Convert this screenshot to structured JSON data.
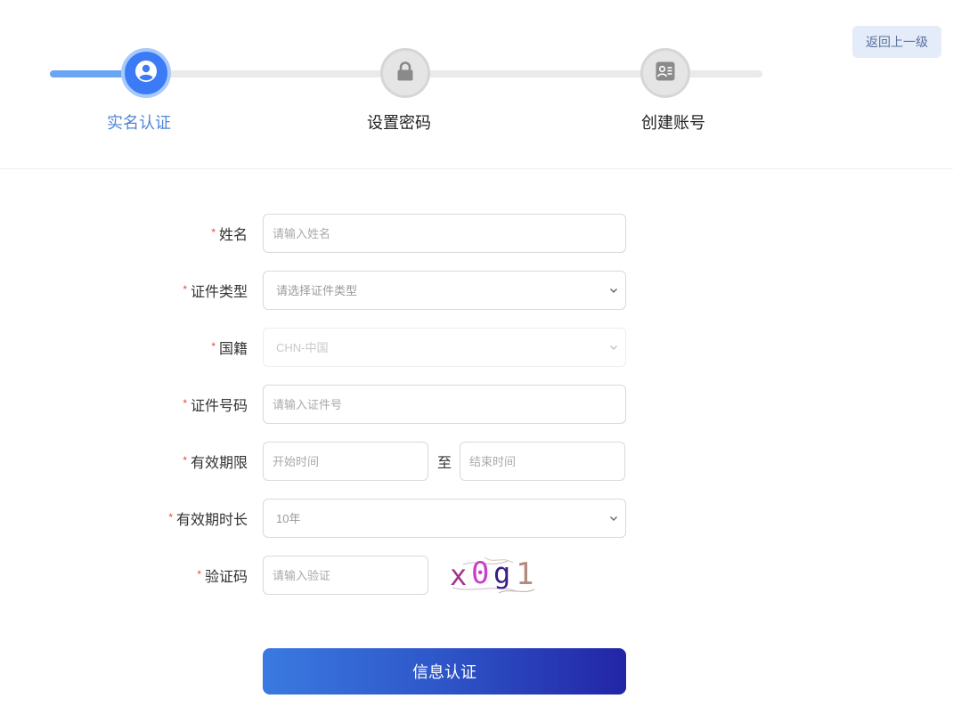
{
  "header": {
    "back_label": "返回上一级",
    "accent_color": "#3b7cf6",
    "steps": [
      {
        "label": "实名认证",
        "icon": "user-icon",
        "state": "active"
      },
      {
        "label": "设置密码",
        "icon": "lock-icon",
        "state": "pending"
      },
      {
        "label": "创建账号",
        "icon": "id-card-icon",
        "state": "pending"
      }
    ]
  },
  "form": {
    "required_mark": "*",
    "name": {
      "label": "姓名",
      "placeholder": "请输入姓名"
    },
    "id_type": {
      "label": "证件类型",
      "selected": "请选择证件类型"
    },
    "nationality": {
      "label": "国籍",
      "selected": "CHN-中国"
    },
    "id_number": {
      "label": "证件号码",
      "placeholder": "请输入证件号"
    },
    "validity": {
      "label": "有效期限",
      "start_placeholder": "开始时间",
      "separator": "至",
      "end_placeholder": "结束时间"
    },
    "duration": {
      "label": "有效期时长",
      "selected": "10年"
    },
    "captcha": {
      "label": "验证码",
      "placeholder": "请输入验证",
      "code": [
        "x",
        "0",
        "g",
        "1"
      ],
      "colors": [
        "#a0348a",
        "#c93fc9",
        "#3a1c86",
        "#b38a7d"
      ]
    },
    "submit_label": "信息认证"
  }
}
